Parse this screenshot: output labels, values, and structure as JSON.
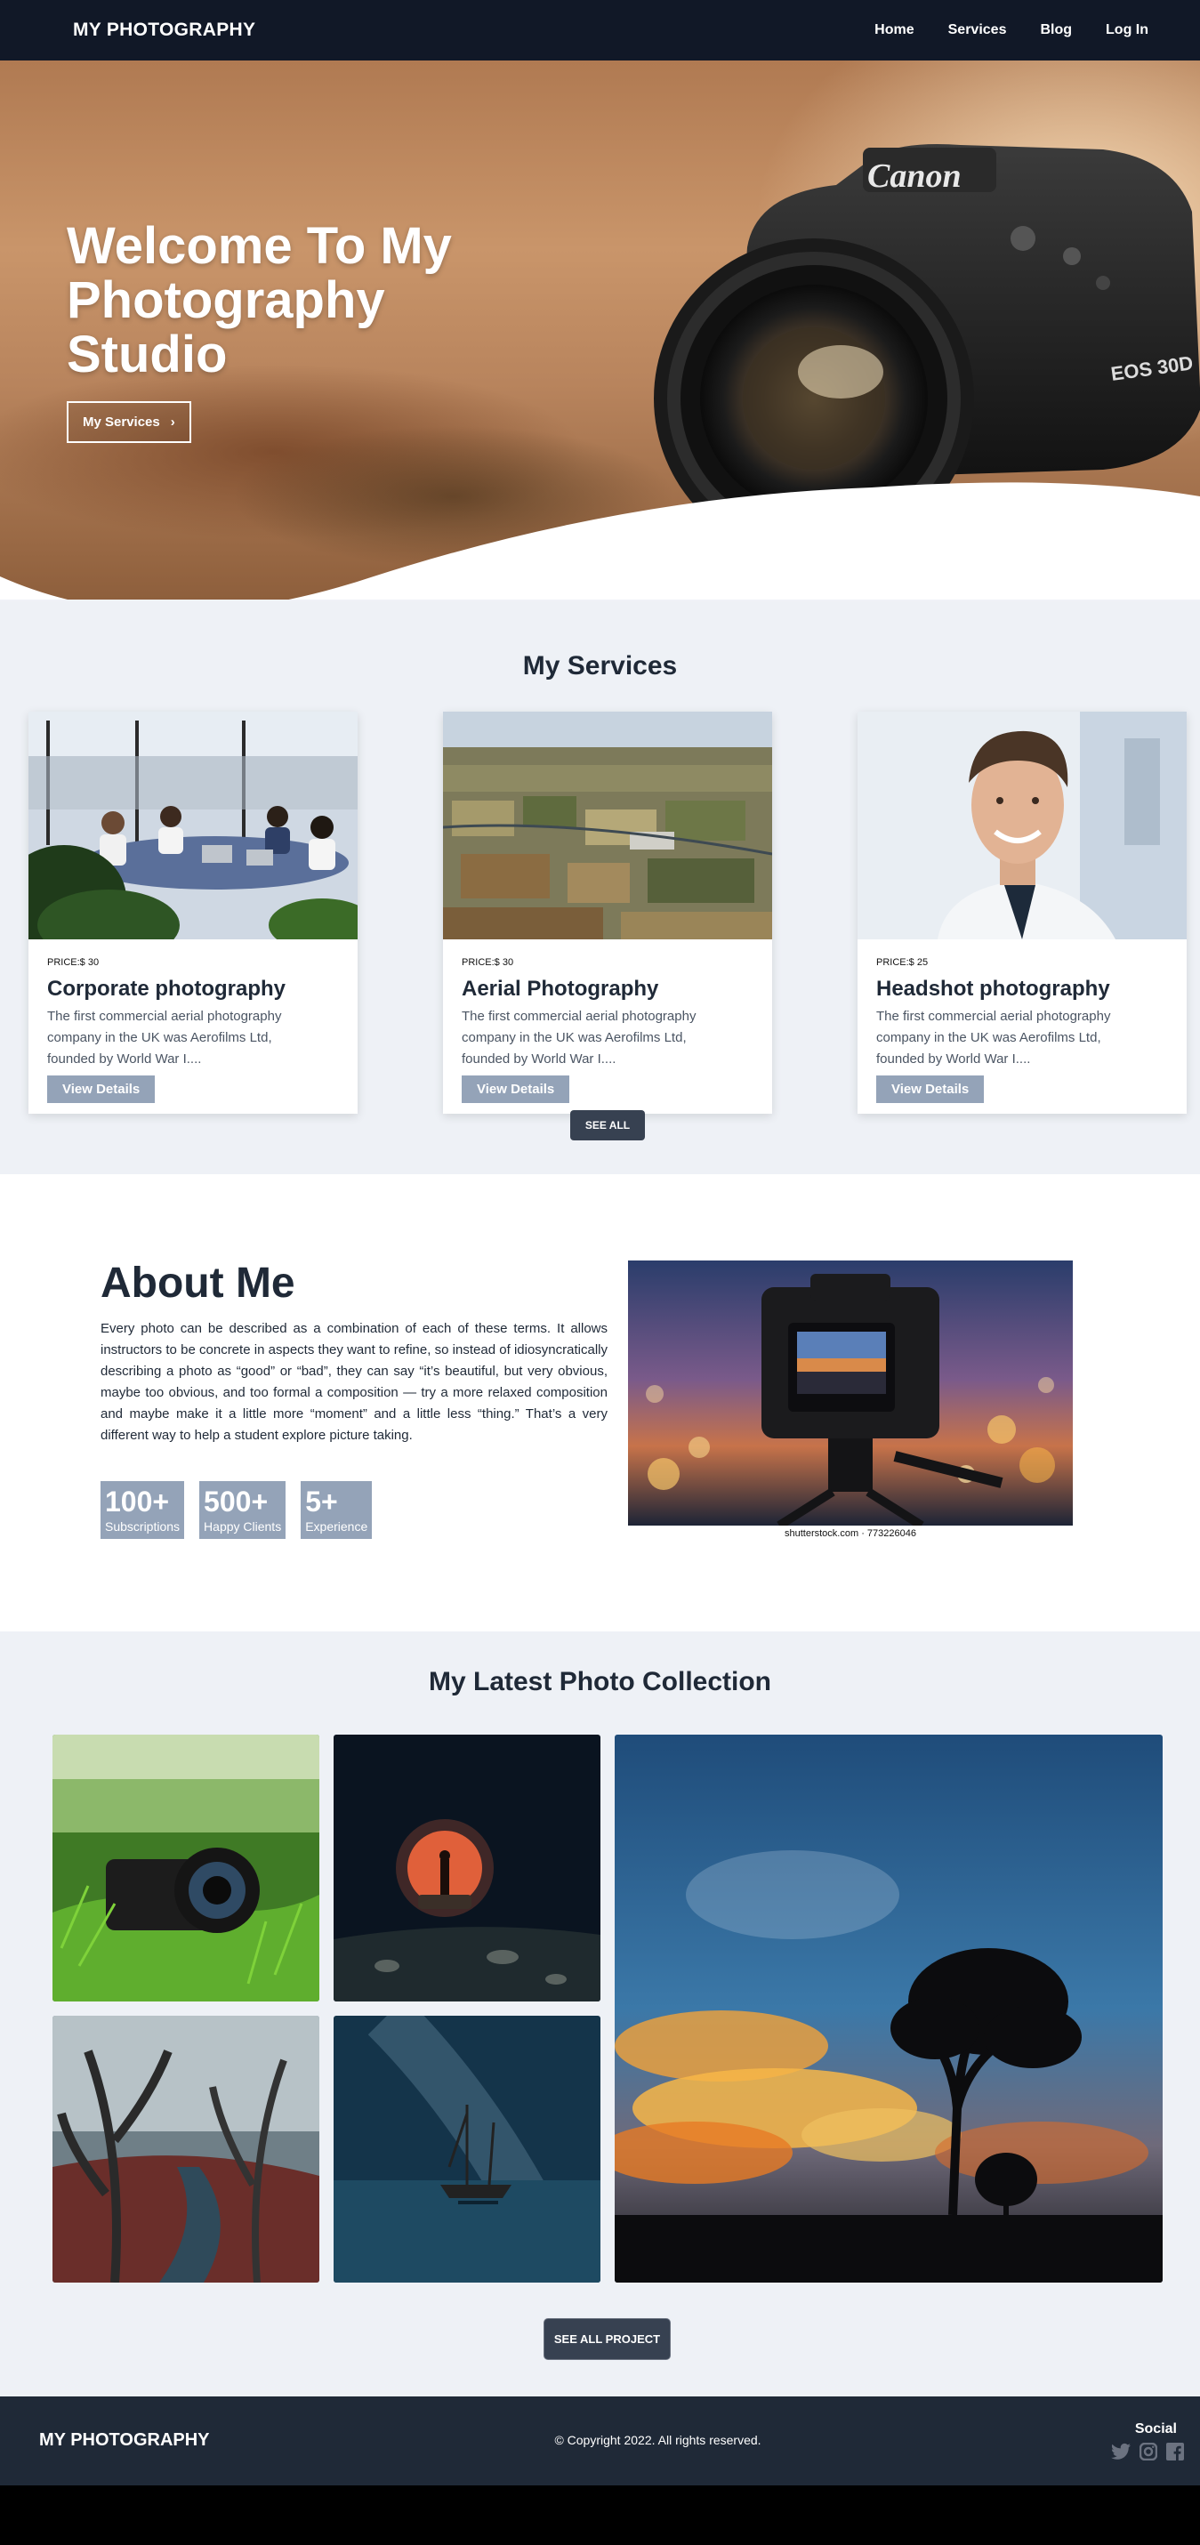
{
  "nav": {
    "brand": "MY PHOTOGRAPHY",
    "links": [
      "Home",
      "Services",
      "Blog",
      "Log In"
    ]
  },
  "hero": {
    "title": "Welcome To My Photography Studio",
    "button": "My Services",
    "camera_brand": "Canon",
    "camera_model": "EOS 30D"
  },
  "services": {
    "title": "My Services",
    "cards": [
      {
        "price": "PRICE:$ 30",
        "title": "Corporate photography",
        "desc": "The first commercial aerial photography company in the UK was Aerofilms Ltd, founded by World War I....",
        "button": "View Details"
      },
      {
        "price": "PRICE:$ 30",
        "title": "Aerial Photography",
        "desc": "The first commercial aerial photography company in the UK was Aerofilms Ltd, founded by World War I....",
        "button": "View Details"
      },
      {
        "price": "PRICE:$ 25",
        "title": "Headshot photography",
        "desc": "The first commercial aerial photography company in the UK was Aerofilms Ltd, founded by World War I....",
        "button": "View Details"
      }
    ],
    "see_all": "SEE ALL"
  },
  "about": {
    "title": "About Me",
    "text": "Every photo can be described as a combination of each of these terms. It allows instructors to be concrete in aspects they want to refine, so instead of idiosyncratically describing a photo as “good” or “bad”, they can say “it’s beautiful, but very obvious, maybe too obvious, and too formal a composition — try a more relaxed composition and maybe make it a little more “moment” and a little less “thing.” That’s a very different way to help a student explore picture taking.",
    "stats": [
      {
        "num": "100+",
        "label": "Subscriptions"
      },
      {
        "num": "500+",
        "label": "Happy Clients"
      },
      {
        "num": "5+",
        "label": "Experience"
      }
    ],
    "caption": "shutterstock.com · 773226046"
  },
  "gallery": {
    "title": "My Latest Photo Collection",
    "button": "SEE ALL PROJECT"
  },
  "footer": {
    "brand": "MY PHOTOGRAPHY",
    "copyright": "© Copyright 2022. All rights reserved.",
    "social_title": "Social",
    "icons": [
      "twitter-icon",
      "instagram-icon",
      "facebook-icon"
    ]
  }
}
